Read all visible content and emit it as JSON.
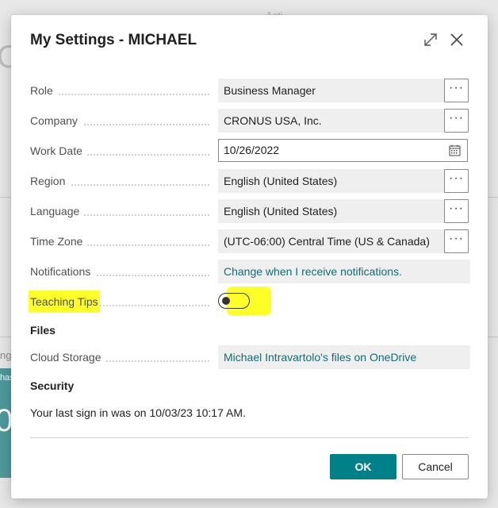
{
  "background": {
    "top_text": "Acti",
    "left_glyph": "O",
    "side_text": "ng",
    "tile_text": "has",
    "tile_number": "0"
  },
  "dialog": {
    "title": "My Settings - MICHAEL",
    "fields": [
      {
        "label": "Role",
        "value": "Business Manager",
        "has_more": true
      },
      {
        "label": "Company",
        "value": "CRONUS USA, Inc.",
        "has_more": true
      },
      {
        "label": "Work Date",
        "value": "10/26/2022",
        "has_calendar": true
      },
      {
        "label": "Region",
        "value": "English (United States)",
        "has_more": true
      },
      {
        "label": "Language",
        "value": "English (United States)",
        "has_more": true
      },
      {
        "label": "Time Zone",
        "value": "(UTC-06:00) Central Time (US & Canada)",
        "has_more": true
      },
      {
        "label": "Notifications",
        "value": "Change when I receive notifications."
      }
    ],
    "more_label": "···",
    "teaching_tips": {
      "label": "Teaching Tips",
      "enabled": false
    },
    "files": {
      "heading": "Files",
      "cloud_storage_label": "Cloud Storage",
      "cloud_storage_value": "Michael Intravartolo's files on OneDrive"
    },
    "security": {
      "heading": "Security",
      "last_sign_in": "Your last sign in was on 10/03/23 10:17 AM."
    },
    "buttons": {
      "ok": "OK",
      "cancel": "Cancel"
    },
    "colors": {
      "accent": "#00818a",
      "link": "#126c75",
      "highlight": "#ffff28"
    }
  }
}
